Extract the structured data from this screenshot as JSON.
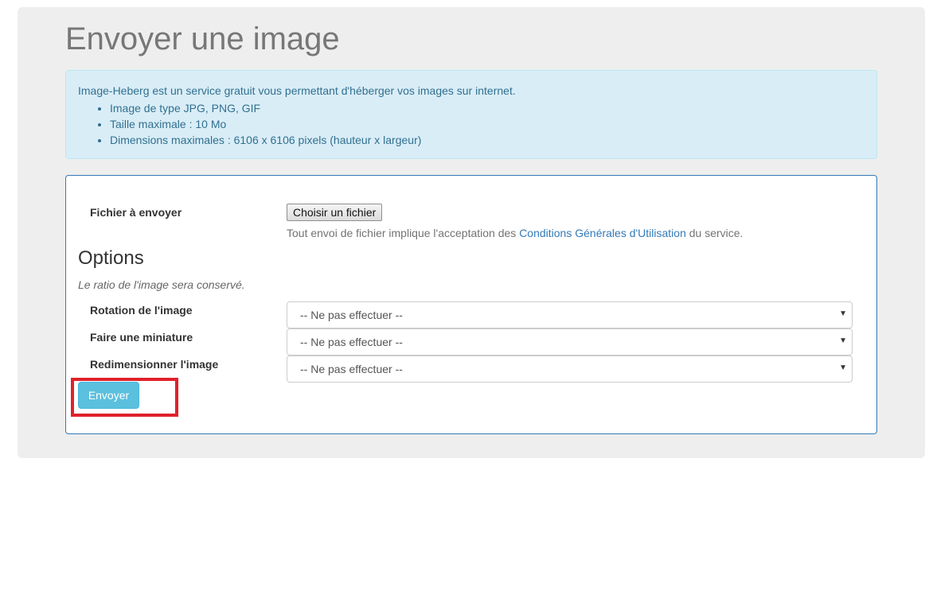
{
  "page": {
    "title": "Envoyer une image"
  },
  "info": {
    "intro": "Image-Heberg est un service gratuit vous permettant d'héberger vos images sur internet.",
    "items": [
      "Image de type JPG, PNG, GIF",
      "Taille maximale : 10 Mo",
      "Dimensions maximales : 6106 x 6106 pixels (hauteur x largeur)"
    ]
  },
  "upload": {
    "file_label": "Fichier à envoyer",
    "file_button": "Choisir un fichier",
    "help_prefix": "Tout envoi de fichier implique l'acceptation des ",
    "help_link": "Conditions Générales d'Utilisation",
    "help_suffix": " du service."
  },
  "options": {
    "title": "Options",
    "note": "Le ratio de l'image sera conservé.",
    "rotation": {
      "label": "Rotation de l'image",
      "value": "-- Ne pas effectuer --"
    },
    "thumbnail": {
      "label": "Faire une miniature",
      "value": "-- Ne pas effectuer --"
    },
    "resize": {
      "label": "Redimensionner l'image",
      "value": "-- Ne pas effectuer --"
    }
  },
  "submit": {
    "label": "Envoyer"
  },
  "colors": {
    "primary": "#337ab7",
    "info_button": "#5bc0de",
    "info_background": "#d9edf7",
    "info_text": "#31708f",
    "highlight": "#e0212a"
  },
  "icons": {
    "select_arrow": "chevron-down-icon"
  }
}
